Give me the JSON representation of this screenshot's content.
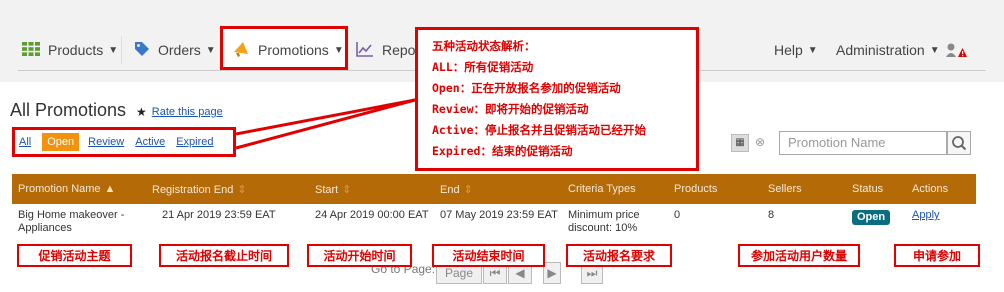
{
  "nav": {
    "items": [
      {
        "label": "Products",
        "icon": "grid-icon"
      },
      {
        "label": "Orders",
        "icon": "tag-icon"
      },
      {
        "label": "Promotions",
        "icon": "megaphone-icon"
      },
      {
        "label": "Repo",
        "icon": "chart-icon"
      }
    ],
    "right": [
      {
        "label": "Help"
      },
      {
        "label": "Administration"
      }
    ]
  },
  "page": {
    "title": "All Promotions",
    "rate_link": "Rate this page"
  },
  "filters": {
    "tabs": [
      "All",
      "Open",
      "Review",
      "Active",
      "Expired"
    ],
    "active": "Open"
  },
  "callout": {
    "lines": [
      "五种活动状态解析：",
      "ALL：所有促销活动",
      "Open：正在开放报名参加的促销活动",
      "Review：即将开始的促销活动",
      "Active：停止报名并且促销活动已经开始",
      "Expired：结束的促销活动"
    ]
  },
  "search": {
    "placeholder": "Promotion Name"
  },
  "table": {
    "headers": [
      "Promotion Name",
      "Registration End",
      "Start",
      "End",
      "Criteria Types",
      "Products",
      "Sellers",
      "Status",
      "Actions"
    ],
    "row": {
      "name_line1": "Big Home makeover -",
      "name_line2": "Appliances",
      "registration_end": "21 Apr 2019 23:59 EAT",
      "start": "24 Apr 2019 00:00 EAT",
      "end": "07 May 2019 23:59 EAT",
      "criteria_line1": "Minimum price",
      "criteria_line2": "discount: 10%",
      "products": "0",
      "sellers": "8",
      "status": "Open",
      "action": "Apply"
    }
  },
  "annotations": [
    "促销活动主题",
    "活动报名截止时间",
    "活动开始时间",
    "活动结束时间",
    "活动报名要求",
    "参加活动用户数量",
    "申请参加"
  ],
  "pager": {
    "goto_label": "Go to Page:",
    "page_placeholder": "Page"
  },
  "colors": {
    "accent_orange": "#f3920f",
    "header_brown": "#b56a08",
    "annotation_red": "#e00000",
    "status_teal": "#0b6e80",
    "link_blue": "#1a55b0"
  }
}
